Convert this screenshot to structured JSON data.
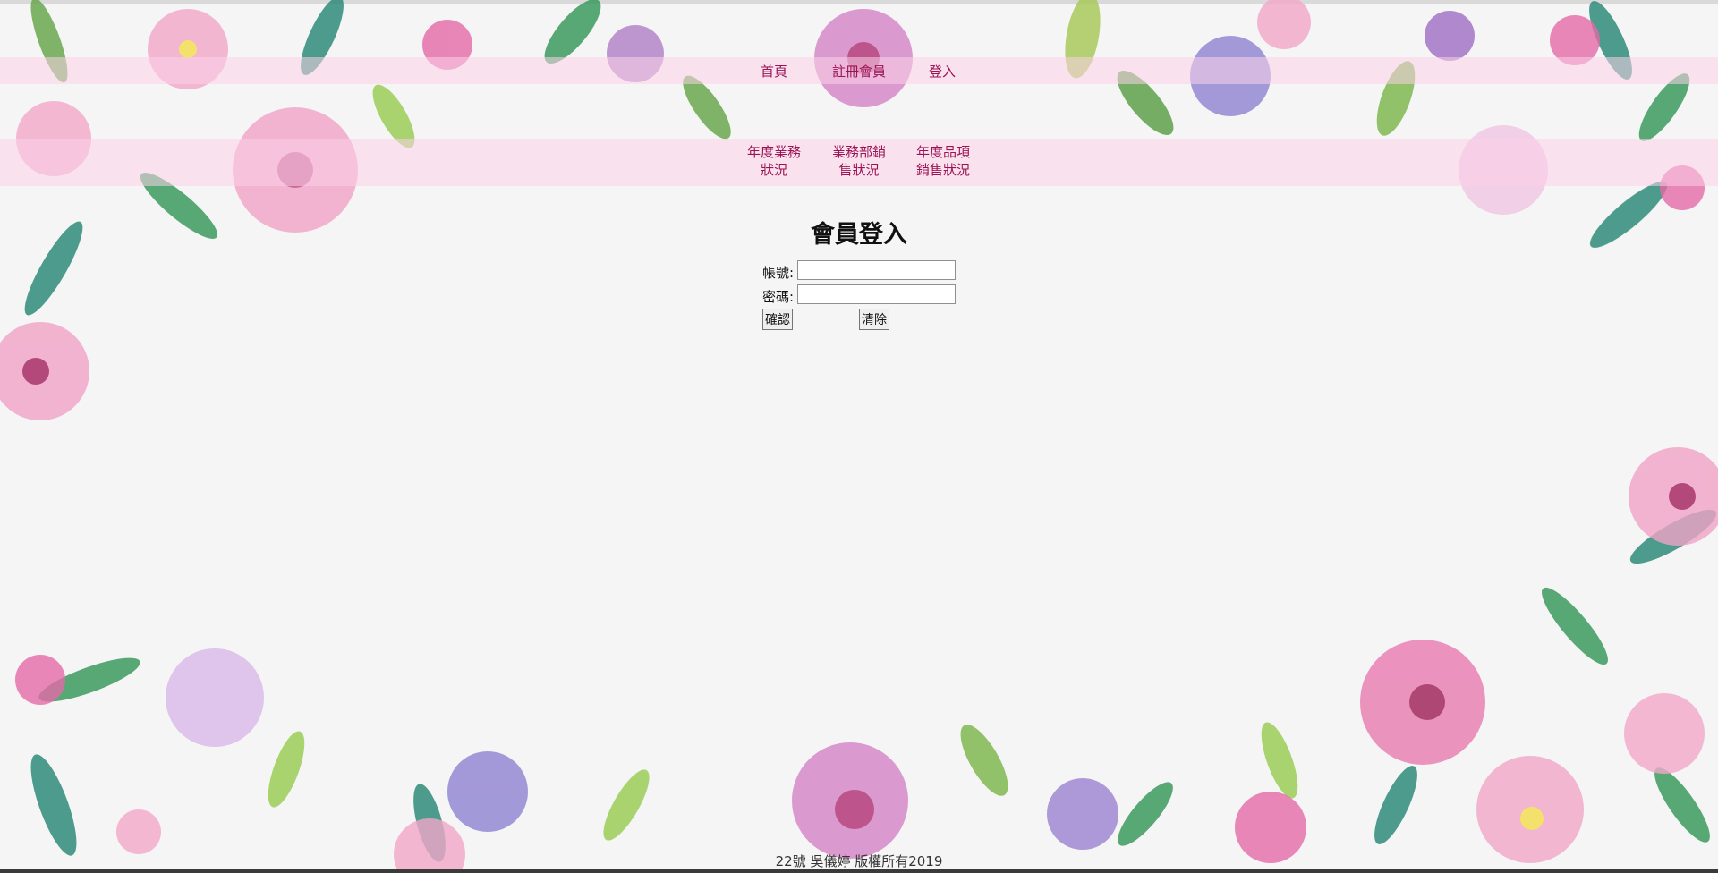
{
  "nav": {
    "home": "首頁",
    "register": "註冊會員",
    "login": "登入",
    "annual_business": "年度業務\n狀況",
    "dept_sales": "業務部銷\n售狀況",
    "annual_items": "年度品項\n銷售狀況"
  },
  "login_form": {
    "title": "會員登入",
    "account_label": "帳號:",
    "account_value": "",
    "password_label": "密碼:",
    "password_value": "",
    "confirm_button": "確認",
    "clear_button": "清除"
  },
  "footer": {
    "text": "22號 吳儀婷 版權所有2019"
  },
  "colors": {
    "nav_link": "#9c1355",
    "nav_band": "#fcd2e8",
    "page_background": "#f5f5f5"
  }
}
